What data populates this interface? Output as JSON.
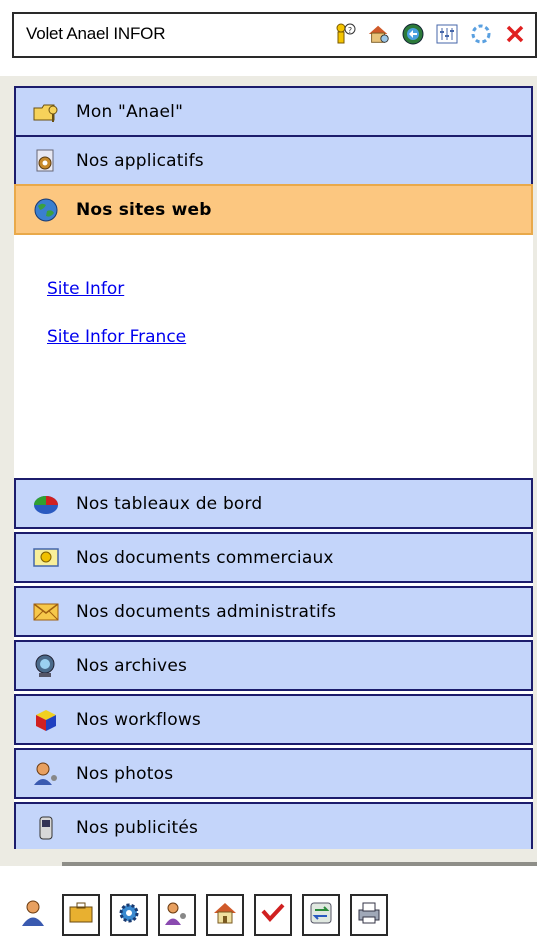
{
  "title": "Volet Anael INFOR",
  "title_icons": [
    "help-person-icon",
    "home-search-icon",
    "refresh-globe-icon",
    "equalizer-icon",
    "spinner-icon",
    "close-icon"
  ],
  "sections_top": [
    {
      "label": "Mon \"Anael\"",
      "icon": "folder-key-icon"
    },
    {
      "label": "Nos applicatifs",
      "icon": "gear-doc-icon"
    },
    {
      "label": "Nos sites web",
      "icon": "globe-icon",
      "active": true
    }
  ],
  "links": [
    "Site Infor",
    "Site Infor France"
  ],
  "sections_bottom": [
    {
      "label": "Nos tableaux de bord",
      "icon": "pie-chart-icon"
    },
    {
      "label": "Nos documents commerciaux",
      "icon": "info-bubble-icon"
    },
    {
      "label": "Nos documents administratifs",
      "icon": "envelope-icon"
    },
    {
      "label": "Nos archives",
      "icon": "magnifier-icon"
    },
    {
      "label": "Nos workflows",
      "icon": "cube-icon"
    },
    {
      "label": "Nos photos",
      "icon": "camera-person-icon"
    },
    {
      "label": "Nos publicités",
      "icon": "phone-icon"
    }
  ],
  "bottom_tabs": [
    "user-icon",
    "briefcase-icon",
    "gear-icon",
    "users-icon",
    "house-icon",
    "checkmark-icon",
    "exchange-icon",
    "printer-icon"
  ],
  "colors": {
    "bar": "#c4d5fa",
    "bar_border": "#1c1c6c",
    "active": "#fcc780",
    "link": "#0000ee"
  }
}
